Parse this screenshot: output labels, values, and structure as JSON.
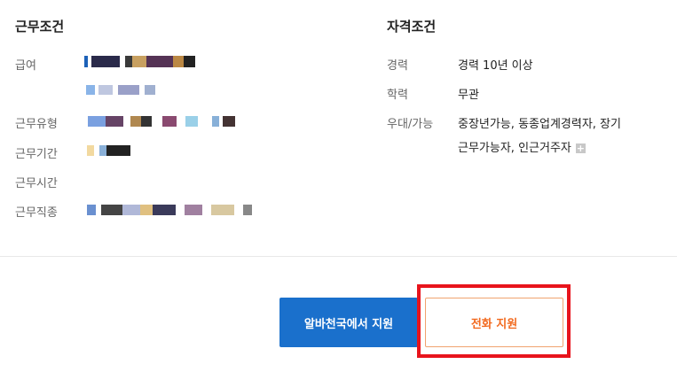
{
  "work_conditions": {
    "title": "근무조건",
    "labels": {
      "pay": "급여",
      "type": "근무유형",
      "period": "근무기간",
      "hours": "근무시간",
      "job": "근무직종"
    }
  },
  "qualifications": {
    "title": "자격조건",
    "rows": [
      {
        "label": "경력",
        "value": "경력 10년 이상"
      },
      {
        "label": "학력",
        "value": "무관"
      },
      {
        "label": "우대/가능",
        "value": "중장년가능, 동종업계경력자, 장기",
        "value2": "근무가능자, 인근거주자"
      }
    ]
  },
  "actions": {
    "apply_online": "알바천국에서 지원",
    "apply_phone": "전화 지원"
  },
  "colors": {
    "primary": "#1a70cc",
    "accent": "#f26a1f",
    "highlight": "#e8141c"
  }
}
